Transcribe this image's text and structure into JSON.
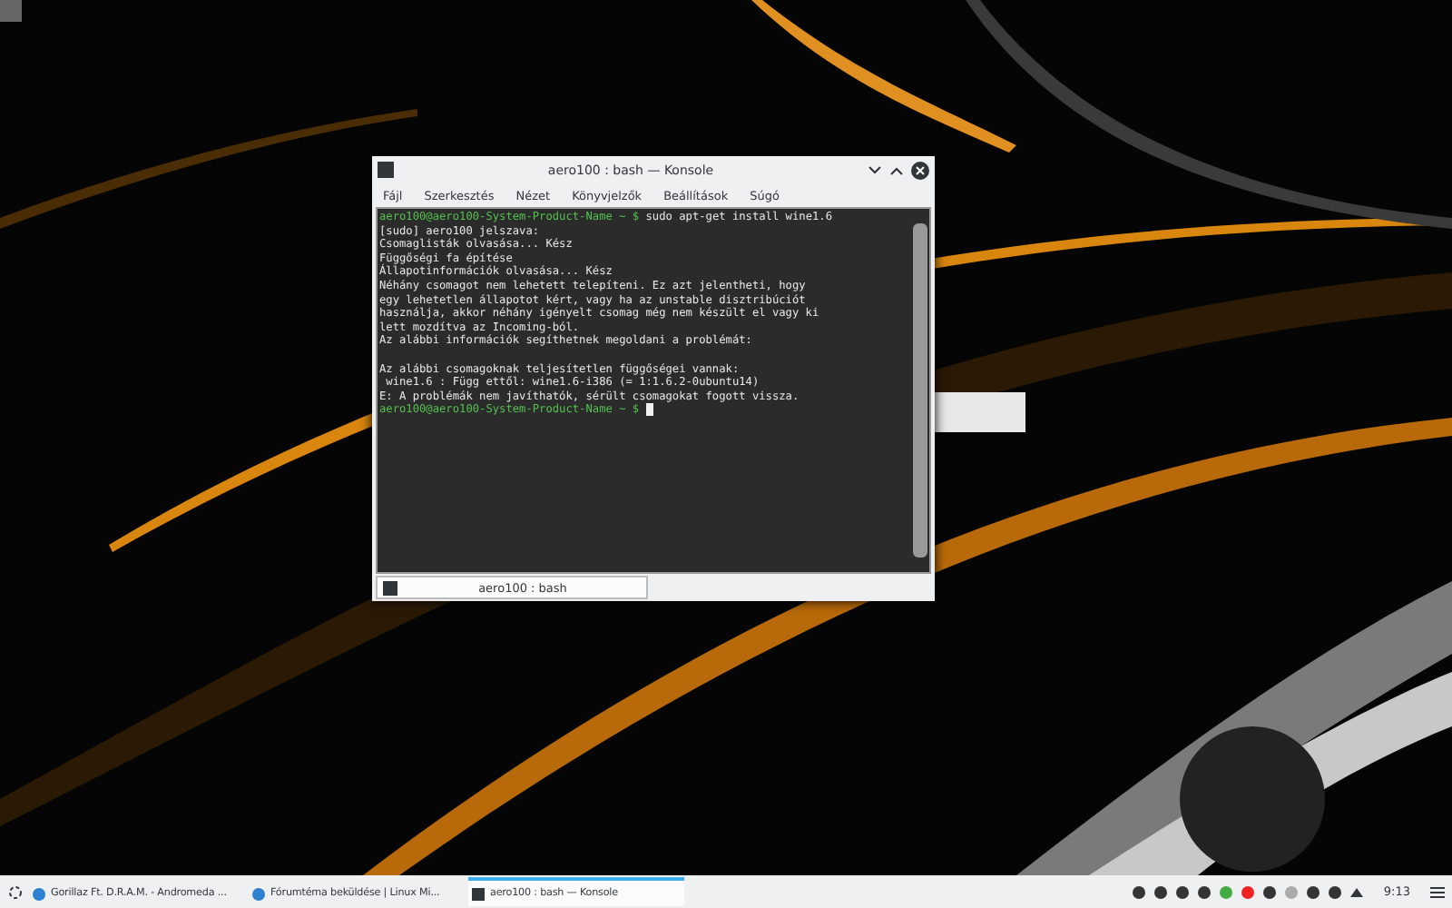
{
  "window": {
    "title": "aero100 : bash — Konsole"
  },
  "menu": [
    "Fájl",
    "Szerkesztés",
    "Nézet",
    "Könyvjelzők",
    "Beállítások",
    "Súgó"
  ],
  "terminal": {
    "lines": [
      {
        "kind": "prompt",
        "prompt": "aero100@aero100-System-Product-Name ~ $",
        "text": "sudo apt-get install wine1.6"
      },
      {
        "kind": "output",
        "text": "[sudo] aero100 jelszava:"
      },
      {
        "kind": "output",
        "text": "Csomaglisták olvasása... Kész"
      },
      {
        "kind": "output",
        "text": "Függőségi fa építése"
      },
      {
        "kind": "output",
        "text": "Állapotinformációk olvasása... Kész"
      },
      {
        "kind": "output",
        "text": "Néhány csomagot nem lehetett telepíteni. Ez azt jelentheti, hogy"
      },
      {
        "kind": "output",
        "text": "egy lehetetlen állapotot kért, vagy ha az unstable disztribúciót"
      },
      {
        "kind": "output",
        "text": "használja, akkor néhány igényelt csomag még nem készült el vagy ki"
      },
      {
        "kind": "output",
        "text": "lett mozdítva az Incoming-ból."
      },
      {
        "kind": "output",
        "text": "Az alábbi információk segíthetnek megoldani a problémát:"
      },
      {
        "kind": "blank"
      },
      {
        "kind": "output",
        "text": "Az alábbi csomagoknak teljesítetlen függőségei vannak:"
      },
      {
        "kind": "output",
        "text": " wine1.6 : Függ ettől: wine1.6-i386 (= 1:1.6.2-0ubuntu14)"
      },
      {
        "kind": "output",
        "text": "E: A problémák nem javíthatók, sérült csomagokat fogott vissza."
      },
      {
        "kind": "prompt",
        "prompt": "aero100@aero100-System-Product-Name ~ $",
        "cursor": true
      }
    ]
  },
  "tabs": [
    {
      "label": "aero100 : bash",
      "selected": true
    }
  ],
  "taskbar": {
    "tasks": [
      {
        "kind": "browser",
        "label": "Gorillaz Ft. D.R.A.M. - Andromeda ...",
        "selected": false
      },
      {
        "kind": "browser",
        "label": "Fórumtéma beküldése | Linux Mi...",
        "selected": false
      },
      {
        "kind": "terminal",
        "label": "aero100 : bash — Konsole",
        "selected": true
      }
    ],
    "clock": "9:13"
  }
}
